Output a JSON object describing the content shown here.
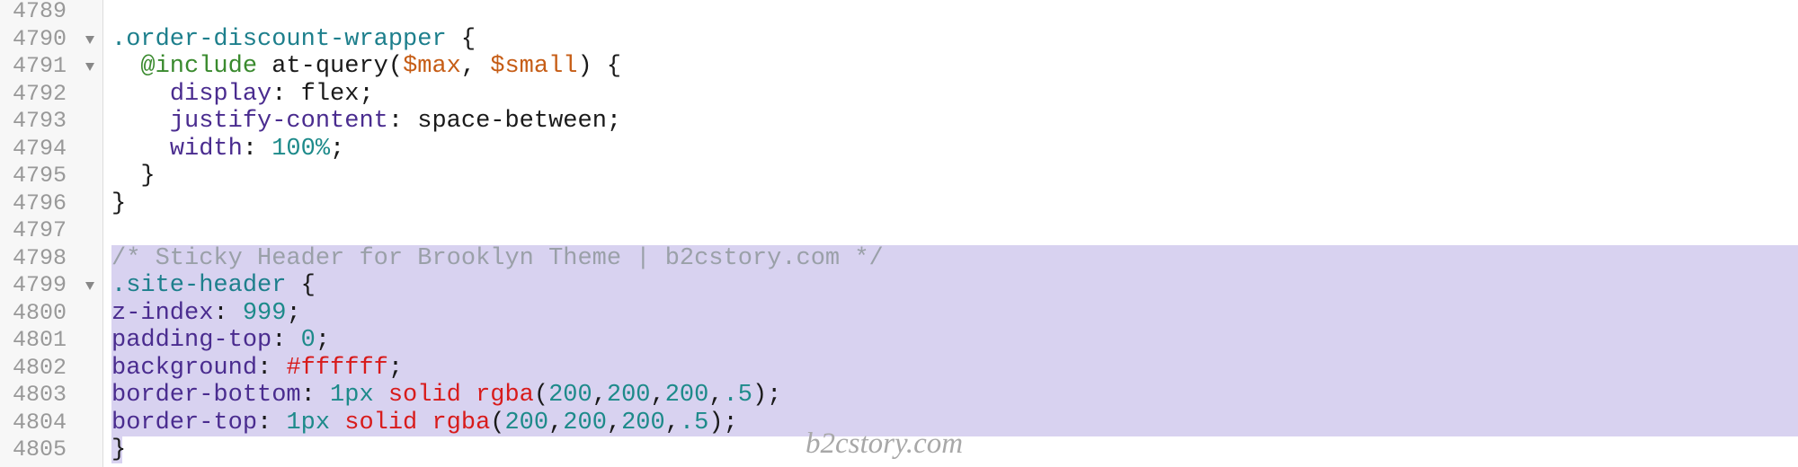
{
  "editor": {
    "lines": [
      {
        "num": "4789",
        "fold": false,
        "tokens": []
      },
      {
        "num": "4790",
        "fold": true,
        "tokens": [
          {
            "t": ".order-discount-wrapper",
            "c": "sel"
          },
          {
            "t": " {",
            "c": "plain"
          }
        ]
      },
      {
        "num": "4791",
        "fold": true,
        "tokens": [
          {
            "t": "  ",
            "c": "plain"
          },
          {
            "t": "@include",
            "c": "at"
          },
          {
            "t": " at-query(",
            "c": "plain"
          },
          {
            "t": "$max",
            "c": "var"
          },
          {
            "t": ", ",
            "c": "plain"
          },
          {
            "t": "$small",
            "c": "var"
          },
          {
            "t": ") {",
            "c": "plain"
          }
        ]
      },
      {
        "num": "4792",
        "fold": false,
        "tokens": [
          {
            "t": "    ",
            "c": "plain"
          },
          {
            "t": "display",
            "c": "prop"
          },
          {
            "t": ": flex;",
            "c": "plain"
          }
        ]
      },
      {
        "num": "4793",
        "fold": false,
        "tokens": [
          {
            "t": "    ",
            "c": "plain"
          },
          {
            "t": "justify-content",
            "c": "prop"
          },
          {
            "t": ": space-between;",
            "c": "plain"
          }
        ]
      },
      {
        "num": "4794",
        "fold": false,
        "tokens": [
          {
            "t": "    ",
            "c": "plain"
          },
          {
            "t": "width",
            "c": "prop"
          },
          {
            "t": ": ",
            "c": "plain"
          },
          {
            "t": "100%",
            "c": "num"
          },
          {
            "t": ";",
            "c": "plain"
          }
        ]
      },
      {
        "num": "4795",
        "fold": false,
        "tokens": [
          {
            "t": "  }",
            "c": "plain"
          }
        ]
      },
      {
        "num": "4796",
        "fold": false,
        "tokens": [
          {
            "t": "}",
            "c": "plain"
          }
        ]
      },
      {
        "num": "4797",
        "fold": false,
        "tokens": []
      },
      {
        "num": "4798",
        "fold": false,
        "tokens": [
          {
            "t": "/* Sticky Header for Brooklyn Theme | b2cstory.com */",
            "c": "com"
          }
        ]
      },
      {
        "num": "4799",
        "fold": true,
        "tokens": [
          {
            "t": ".site-header",
            "c": "sel"
          },
          {
            "t": " {",
            "c": "plain"
          }
        ]
      },
      {
        "num": "4800",
        "fold": false,
        "tokens": [
          {
            "t": "z-index",
            "c": "prop"
          },
          {
            "t": ": ",
            "c": "plain"
          },
          {
            "t": "999",
            "c": "num"
          },
          {
            "t": ";",
            "c": "plain"
          }
        ]
      },
      {
        "num": "4801",
        "fold": false,
        "tokens": [
          {
            "t": "padding-top",
            "c": "prop"
          },
          {
            "t": ": ",
            "c": "plain"
          },
          {
            "t": "0",
            "c": "num"
          },
          {
            "t": ";",
            "c": "plain"
          }
        ]
      },
      {
        "num": "4802",
        "fold": false,
        "tokens": [
          {
            "t": "background",
            "c": "prop"
          },
          {
            "t": ": ",
            "c": "plain"
          },
          {
            "t": "#ffffff",
            "c": "red"
          },
          {
            "t": ";",
            "c": "plain"
          }
        ]
      },
      {
        "num": "4803",
        "fold": false,
        "tokens": [
          {
            "t": "border-bottom",
            "c": "prop"
          },
          {
            "t": ": ",
            "c": "plain"
          },
          {
            "t": "1px",
            "c": "num"
          },
          {
            "t": " ",
            "c": "plain"
          },
          {
            "t": "solid",
            "c": "red"
          },
          {
            "t": " ",
            "c": "plain"
          },
          {
            "t": "rgba",
            "c": "red"
          },
          {
            "t": "(",
            "c": "plain"
          },
          {
            "t": "200",
            "c": "num"
          },
          {
            "t": ",",
            "c": "plain"
          },
          {
            "t": "200",
            "c": "num"
          },
          {
            "t": ",",
            "c": "plain"
          },
          {
            "t": "200",
            "c": "num"
          },
          {
            "t": ",",
            "c": "plain"
          },
          {
            "t": ".5",
            "c": "num"
          },
          {
            "t": ");",
            "c": "plain"
          }
        ]
      },
      {
        "num": "4804",
        "fold": false,
        "tokens": [
          {
            "t": "border-top",
            "c": "prop"
          },
          {
            "t": ": ",
            "c": "plain"
          },
          {
            "t": "1px",
            "c": "num"
          },
          {
            "t": " ",
            "c": "plain"
          },
          {
            "t": "solid",
            "c": "red"
          },
          {
            "t": " ",
            "c": "plain"
          },
          {
            "t": "rgba",
            "c": "red"
          },
          {
            "t": "(",
            "c": "plain"
          },
          {
            "t": "200",
            "c": "num"
          },
          {
            "t": ",",
            "c": "plain"
          },
          {
            "t": "200",
            "c": "num"
          },
          {
            "t": ",",
            "c": "plain"
          },
          {
            "t": "200",
            "c": "num"
          },
          {
            "t": ",",
            "c": "plain"
          },
          {
            "t": ".5",
            "c": "num"
          },
          {
            "t": ");",
            "c": "plain"
          }
        ]
      },
      {
        "num": "4805",
        "fold": false,
        "tokens": [
          {
            "t": "}",
            "c": "plain"
          }
        ]
      }
    ],
    "selection": {
      "from_line": 9,
      "to_line": 16,
      "color": "#d8d2f0"
    },
    "colors": {
      "gutter_bg": "#f7f7f7",
      "line_number": "#999999",
      "selector": "#1d7f8c",
      "property": "#4a2c8f",
      "number": "#1d8a8a",
      "variable": "#c65d16",
      "value_keyword": "#d81b1b",
      "at_rule": "#3a8a2e",
      "comment": "#9aa0a8"
    }
  },
  "watermark": {
    "text": "b2cstory.com"
  }
}
